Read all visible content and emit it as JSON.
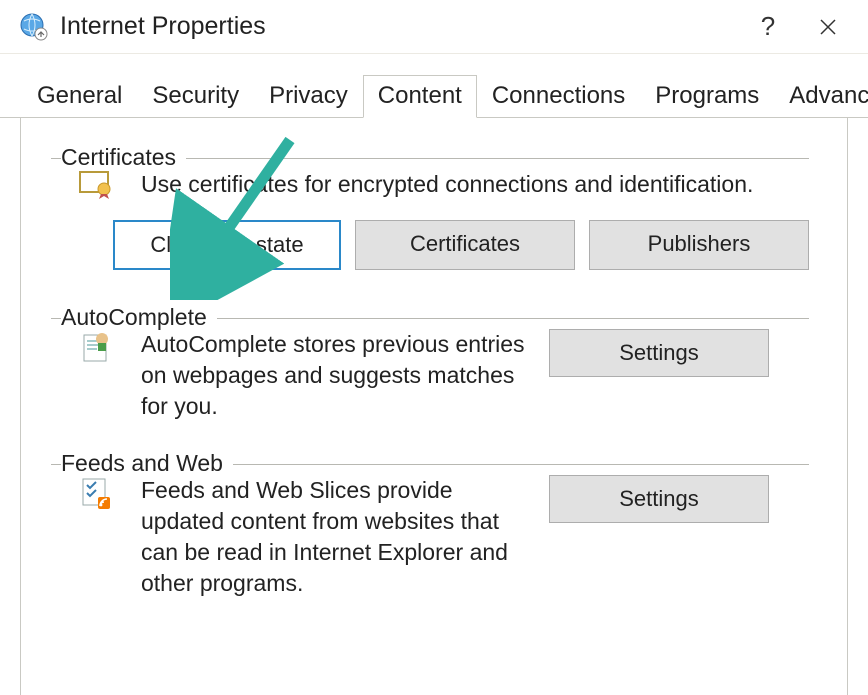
{
  "title": "Internet Properties",
  "tabs": [
    "General",
    "Security",
    "Privacy",
    "Content",
    "Connections",
    "Programs",
    "Advanced"
  ],
  "active_tab": "Content",
  "sections": {
    "certificates": {
      "label": "Certificates",
      "desc": "Use certificates for encrypted connections and identification.",
      "buttons": {
        "clear": "Clear SSL state",
        "certs": "Certificates",
        "pub": "Publishers"
      }
    },
    "autocomplete": {
      "label": "AutoComplete",
      "desc": "AutoComplete stores previous entries on webpages and suggests matches for you.",
      "button": "Settings"
    },
    "feeds": {
      "label": "Feeds and Web",
      "desc": "Feeds and Web Slices provide updated content from websites that can be read in Internet Explorer and other programs.",
      "button": "Settings"
    }
  }
}
